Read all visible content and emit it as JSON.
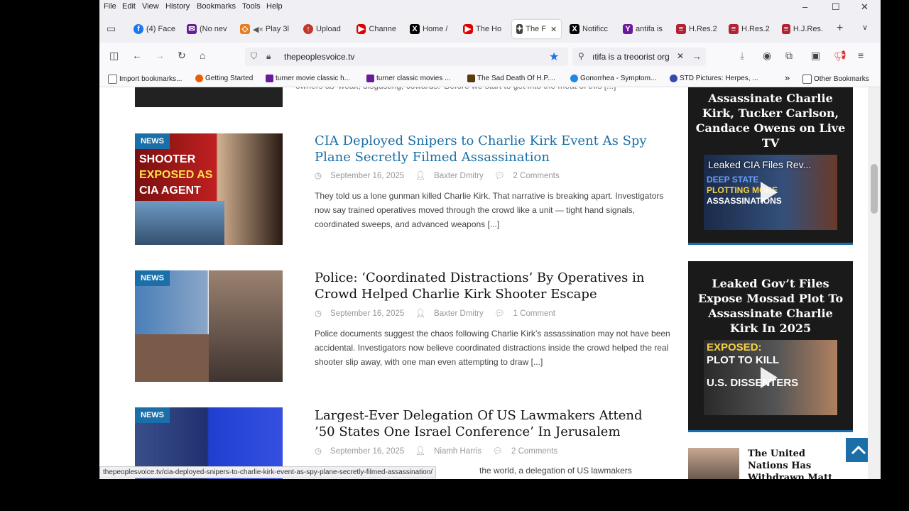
{
  "menu": {
    "file": "File",
    "edit": "Edit",
    "view": "View",
    "history": "History",
    "bookmarks": "Bookmarks",
    "tools": "Tools",
    "help": "Help"
  },
  "window_controls": {
    "minimize": "–",
    "maximize": "☐",
    "close": "✕"
  },
  "tabs": [
    {
      "label": "(4) Face"
    },
    {
      "label": "(No nev"
    },
    {
      "label": "Play 3l"
    },
    {
      "label": "Upload"
    },
    {
      "label": "Channe"
    },
    {
      "label": "Home /"
    },
    {
      "label": "The Ho"
    },
    {
      "label": "The F"
    },
    {
      "label": "Notificc"
    },
    {
      "label": "antifa is"
    },
    {
      "label": "H.Res.2"
    },
    {
      "label": "H.Res.2"
    },
    {
      "label": "H.J.Res."
    }
  ],
  "tab_close": "✕",
  "tab_new": "+",
  "nav": {
    "url": "thepeoplesvoice.tv",
    "search": "ıtifa is a treoorist org",
    "search_clear": "✕",
    "search_go": "→"
  },
  "bookmarks": [
    {
      "label": "Import bookmarks..."
    },
    {
      "label": "Getting Started"
    },
    {
      "label": "turner movie classic h..."
    },
    {
      "label": "turner classic movies ..."
    },
    {
      "label": "The Sad Death Of H.P...."
    },
    {
      "label": "Gonorrhea - Symptom..."
    },
    {
      "label": "STD Pictures: Herpes, ..."
    }
  ],
  "bookmarks_more": "»",
  "bookmarks_other": "Other Bookmarks",
  "top_excerpt": "owners as 'weak, disgusting, cowards.' Before we start to get into the meat of this [...]",
  "posts": [
    {
      "badge": "NEWS",
      "thumb_text1": "SHOOTER",
      "thumb_text2": "EXPOSED AS",
      "thumb_text3": "CIA AGENT",
      "title": "CIA Deployed Snipers to Charlie Kirk Event As Spy Plane Secretly Filmed Assassination",
      "date": "September 16, 2025",
      "author": "Baxter Dmitry",
      "comments": "2 Comments",
      "excerpt": "They told us a lone gunman killed Charlie Kirk. That narrative is breaking apart. Investigators now say trained operatives moved through the crowd like a unit — tight hand signals, coordinated sweeps, and advanced weapons [...]"
    },
    {
      "badge": "NEWS",
      "title": "Police: ‘Coordinated Distractions’ By Operatives in Crowd Helped Charlie Kirk Shooter Escape",
      "date": "September 16, 2025",
      "author": "Baxter Dmitry",
      "comments": "1 Comment",
      "excerpt": "Police documents suggest the chaos following Charlie Kirk’s assassination may not have been accidental. Investigators now believe coordinated distractions inside the crowd helped the real shooter slip away, with one man even attempting to draw [...]"
    },
    {
      "badge": "NEWS",
      "title": "Largest-Ever Delegation Of US Lawmakers Attend ’50 States One Israel Conference’ In Jerusalem",
      "date": "September 16, 2025",
      "author": "Niamh Harris",
      "comments": "2 Comments",
      "excerpt": "the world, a delegation of US lawmakers"
    }
  ],
  "sidebar": [
    {
      "title": "Assassinate Charlie Kirk, Tucker Carlson, Candace Owens on Live TV",
      "video_title": "Leaked CIA Files Rev...",
      "video_text1": "DEEP STATE",
      "video_text2": "PLOTTING MORE",
      "video_text3": "ASSASSINATIONS"
    },
    {
      "title": "Leaked Gov’t Files Expose Mossad Plot To Assassinate Charlie Kirk In 2025",
      "video_text1": "EXPOSED:",
      "video_text2": "PLOT TO KILL",
      "video_text3": "U.S. DISSENTERS"
    },
    {
      "title": "The United Nations Has Withdrawn Matt Hancock’s Job Offer!"
    }
  ],
  "status_url": "thepeoplesvoice.tv/cia-deployed-snipers-to-charlie-kirk-event-as-spy-plane-secretly-filmed-assassination/",
  "colors": {
    "accent": "#1a6fa8",
    "dark": "#1a1a1a"
  }
}
